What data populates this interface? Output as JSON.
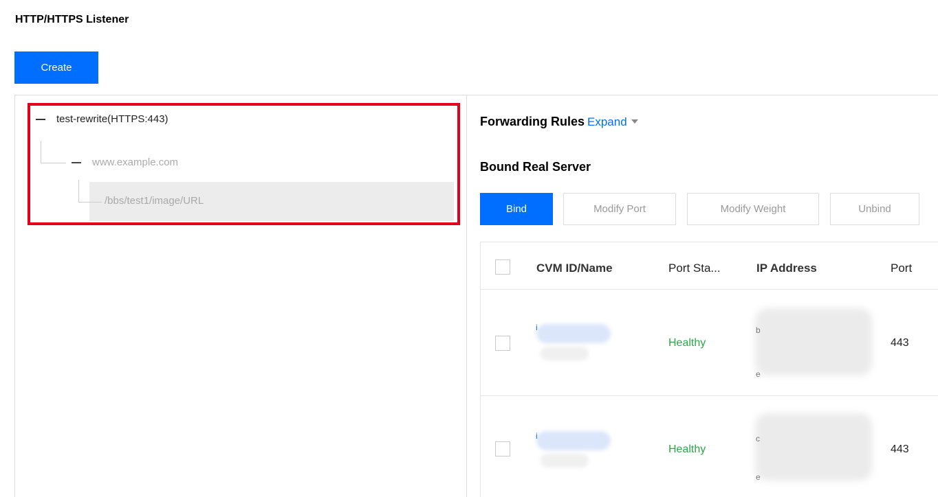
{
  "page": {
    "title": "HTTP/HTTPS Listener"
  },
  "toolbar": {
    "create_label": "Create"
  },
  "tree": {
    "root_label": "test-rewrite(HTTPS:443)",
    "domain_label": "www.example.com",
    "url_label": "/bbs/test1/image/URL"
  },
  "forwarding": {
    "title": "Forwarding Rules",
    "expand_label": "Expand"
  },
  "bound": {
    "title": "Bound Real Server",
    "buttons": {
      "bind": "Bind",
      "modify_port": "Modify Port",
      "modify_weight": "Modify Weight",
      "unbind": "Unbind"
    },
    "table": {
      "headers": [
        "CVM ID/Name",
        "Port Sta...",
        "IP Address",
        "Port"
      ],
      "rows": [
        {
          "cvm_prefix": "i",
          "status": "Healthy",
          "ip_fragments": [
            "b",
            "e"
          ],
          "port": "443"
        },
        {
          "cvm_prefix": "i",
          "status": "Healthy",
          "ip_fragments": [
            "c",
            "e"
          ],
          "port": "443"
        }
      ]
    }
  },
  "colors": {
    "primary": "#006eff",
    "highlight_border": "#e3001b",
    "healthy": "#29a745"
  }
}
